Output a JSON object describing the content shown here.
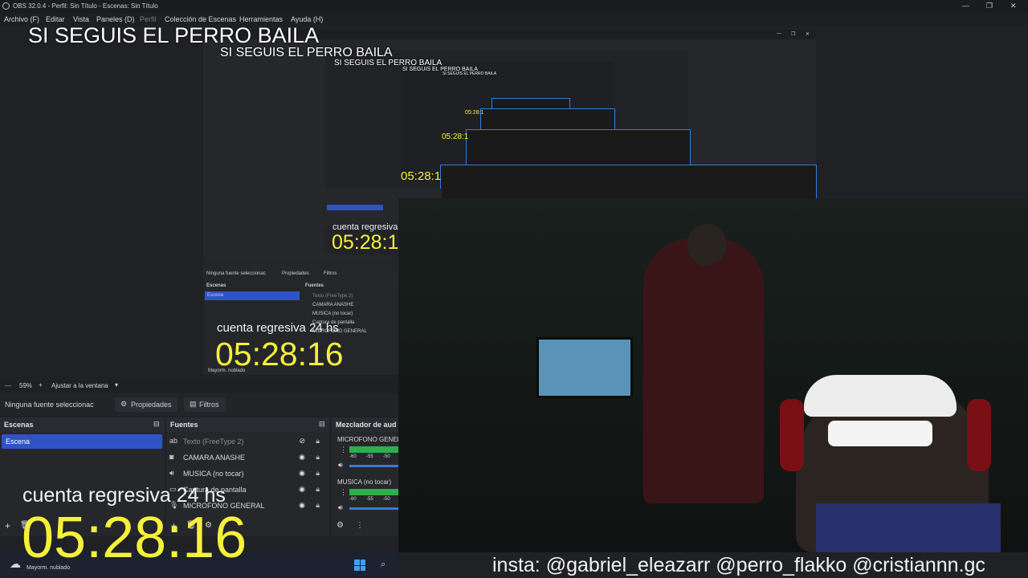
{
  "window": {
    "title": "OBS 32.0.4 - Perfil: Sin Título - Escenas: Sin Título",
    "controls": {
      "minimize": "—",
      "maximize": "❐",
      "close": "✕"
    }
  },
  "menu": {
    "items": [
      "Archivo (F)",
      "Editar",
      "Vista",
      "Paneles (D)",
      "Perfil",
      "Colección de Escenas",
      "Herramientas",
      "Ayuda (H)"
    ]
  },
  "overlay": {
    "headline": "SI SEGUIS EL PERRO BAILA",
    "countdown_label": "cuenta regresiva 24 hs",
    "timer": "05:28:16",
    "timer_partial": "05:28:1",
    "countdown_partial": "cuenta regresiva 2",
    "social": "insta: @gabriel_eleazarr @perro_flakko @cristiannn.gc"
  },
  "zoom_bar": {
    "zoom_value": "59%",
    "fit_label": "Ajustar a la ventana"
  },
  "context_bar": {
    "no_source": "Ninguna fuente seleccionac",
    "properties": "Propiedades",
    "filters": "Filtros"
  },
  "scenes": {
    "title": "Escenas",
    "items": [
      "Escena"
    ]
  },
  "sources": {
    "title": "Fuentes",
    "items": [
      {
        "label": "Texto (FreeType 2)",
        "icon": "text-icon",
        "visible": false
      },
      {
        "label": "CAMARA ANASHE",
        "icon": "camera-icon",
        "visible": true
      },
      {
        "label": "MUSICA (no tocar)",
        "icon": "speaker-icon",
        "visible": true
      },
      {
        "label": "Captura de pantalla",
        "icon": "monitor-icon",
        "visible": true
      },
      {
        "label": "MICROFONO GENERAL",
        "icon": "mic-icon",
        "visible": true
      }
    ]
  },
  "mixer": {
    "title": "Mezclador de aud",
    "channels": [
      {
        "name": "MICROFONO GENERA",
        "scale": [
          "-60",
          "-55",
          "-50"
        ]
      },
      {
        "name": "MUSICA (no tocar)",
        "scale": [
          "-60",
          "-55",
          "-50"
        ]
      }
    ]
  },
  "taskbar": {
    "weather": "Mayorm. nublado"
  },
  "colors": {
    "accent": "#2f53c6",
    "timer": "#f5f13b",
    "selection_border": "#2e7de0"
  }
}
